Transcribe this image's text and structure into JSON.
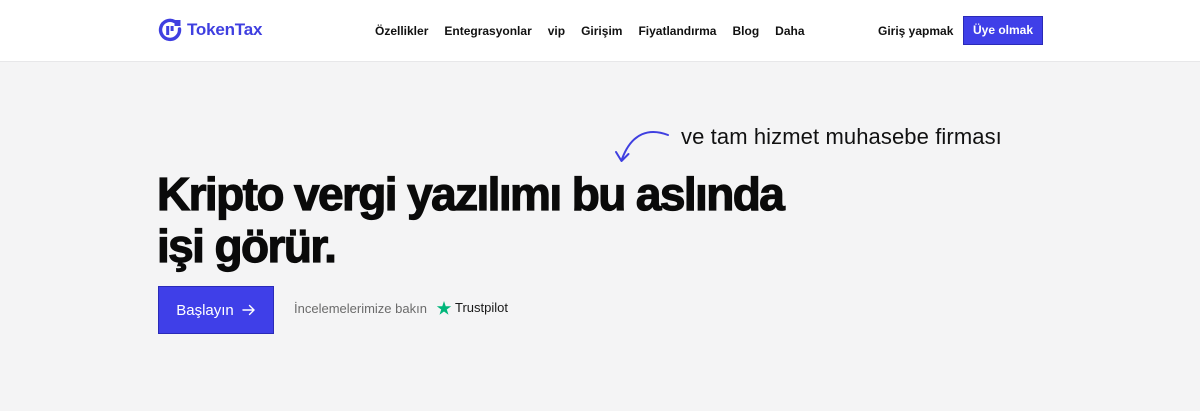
{
  "brand": {
    "name": "TokenTax",
    "color": "#3f3fe0"
  },
  "nav": {
    "items": [
      {
        "label": "Özellikler"
      },
      {
        "label": "Entegrasyonlar"
      },
      {
        "label": "vip"
      },
      {
        "label": "Girişim"
      },
      {
        "label": "Fiyatlandırma"
      },
      {
        "label": "Blog"
      },
      {
        "label": "Daha"
      }
    ],
    "signin_label": "Giriş yapmak",
    "signup_label": "Üye olmak"
  },
  "hero": {
    "annotation": "ve tam hizmet muhasebe firması",
    "headline_line1": "Kripto vergi yazılımı bu aslında",
    "headline_line2": "işi görür.",
    "cta_label": "Başlayın",
    "reviews_text": "İncelemelerimize bakın",
    "trustpilot_label": "Trustpilot"
  },
  "colors": {
    "accent": "#3f3fe8",
    "background": "#f4f4f5",
    "trustpilot_green": "#00b67a"
  },
  "icons": {
    "logo": "tokentax-logo-icon",
    "annotation_arrow": "curved-arrow-icon",
    "cta_arrow": "arrow-right-icon",
    "trustpilot_star": "star-icon"
  }
}
